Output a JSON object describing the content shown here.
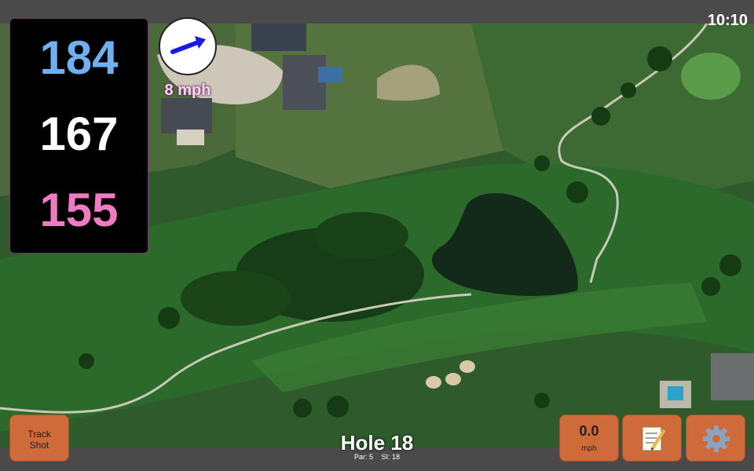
{
  "status": {
    "time": "10:10"
  },
  "distances": {
    "back": "184",
    "middle": "167",
    "front": "155"
  },
  "wind": {
    "speed_label": "8 mph",
    "arrow_icon": "wind-direction-arrow-icon"
  },
  "hole": {
    "title": "Hole 18",
    "par": "Par: 5",
    "si": "SI: 18"
  },
  "buttons": {
    "track_shot_line1": "Track",
    "track_shot_line2": "Shot",
    "speed_value": "0.0",
    "speed_unit": "mph",
    "scorecard_icon": "memo-icon",
    "settings_icon": "gear-icon"
  },
  "colors": {
    "back_distance": "#6fb0f2",
    "middle_distance": "#ffffff",
    "front_distance": "#f07bc4",
    "button": "#cf6a3b",
    "wind_arrow": "#1a1ae6"
  }
}
